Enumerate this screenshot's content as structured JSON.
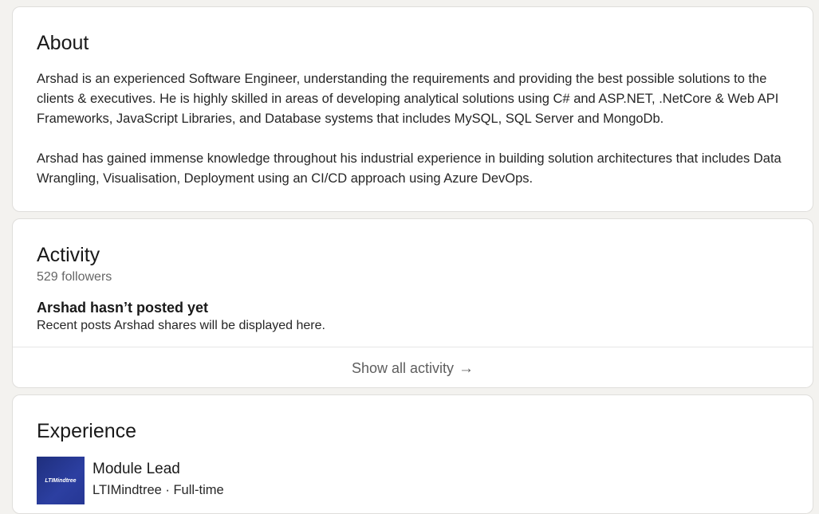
{
  "about": {
    "title": "About",
    "paragraphs": [
      "Arshad is an experienced Software Engineer, understanding the requirements and providing the best possible solutions to the clients & executives. He is highly skilled in areas of developing analytical solutions using C# and ASP.NET, .NetCore & Web API Frameworks, JavaScript Libraries, and Database systems that includes MySQL, SQL Server and MongoDb.",
      "Arshad has gained immense knowledge throughout his industrial experience in building solution architectures that includes Data Wrangling, Visualisation, Deployment using an CI/CD approach using Azure DevOps."
    ]
  },
  "activity": {
    "title": "Activity",
    "followers": "529 followers",
    "empty_title": "Arshad hasn’t posted yet",
    "empty_subtitle": "Recent posts Arshad shares will be displayed here.",
    "show_all_label": "Show all activity",
    "show_all_icon": "arrow-right-icon"
  },
  "experience": {
    "title": "Experience",
    "items": [
      {
        "logo_text": "LTIMindtree",
        "role": "Module Lead",
        "company_line": "LTIMindtree · Full-time"
      }
    ]
  },
  "colors": {
    "page_bg": "#f3f2ef",
    "card_bg": "#ffffff",
    "logo_bg": "#2c3fa1"
  }
}
